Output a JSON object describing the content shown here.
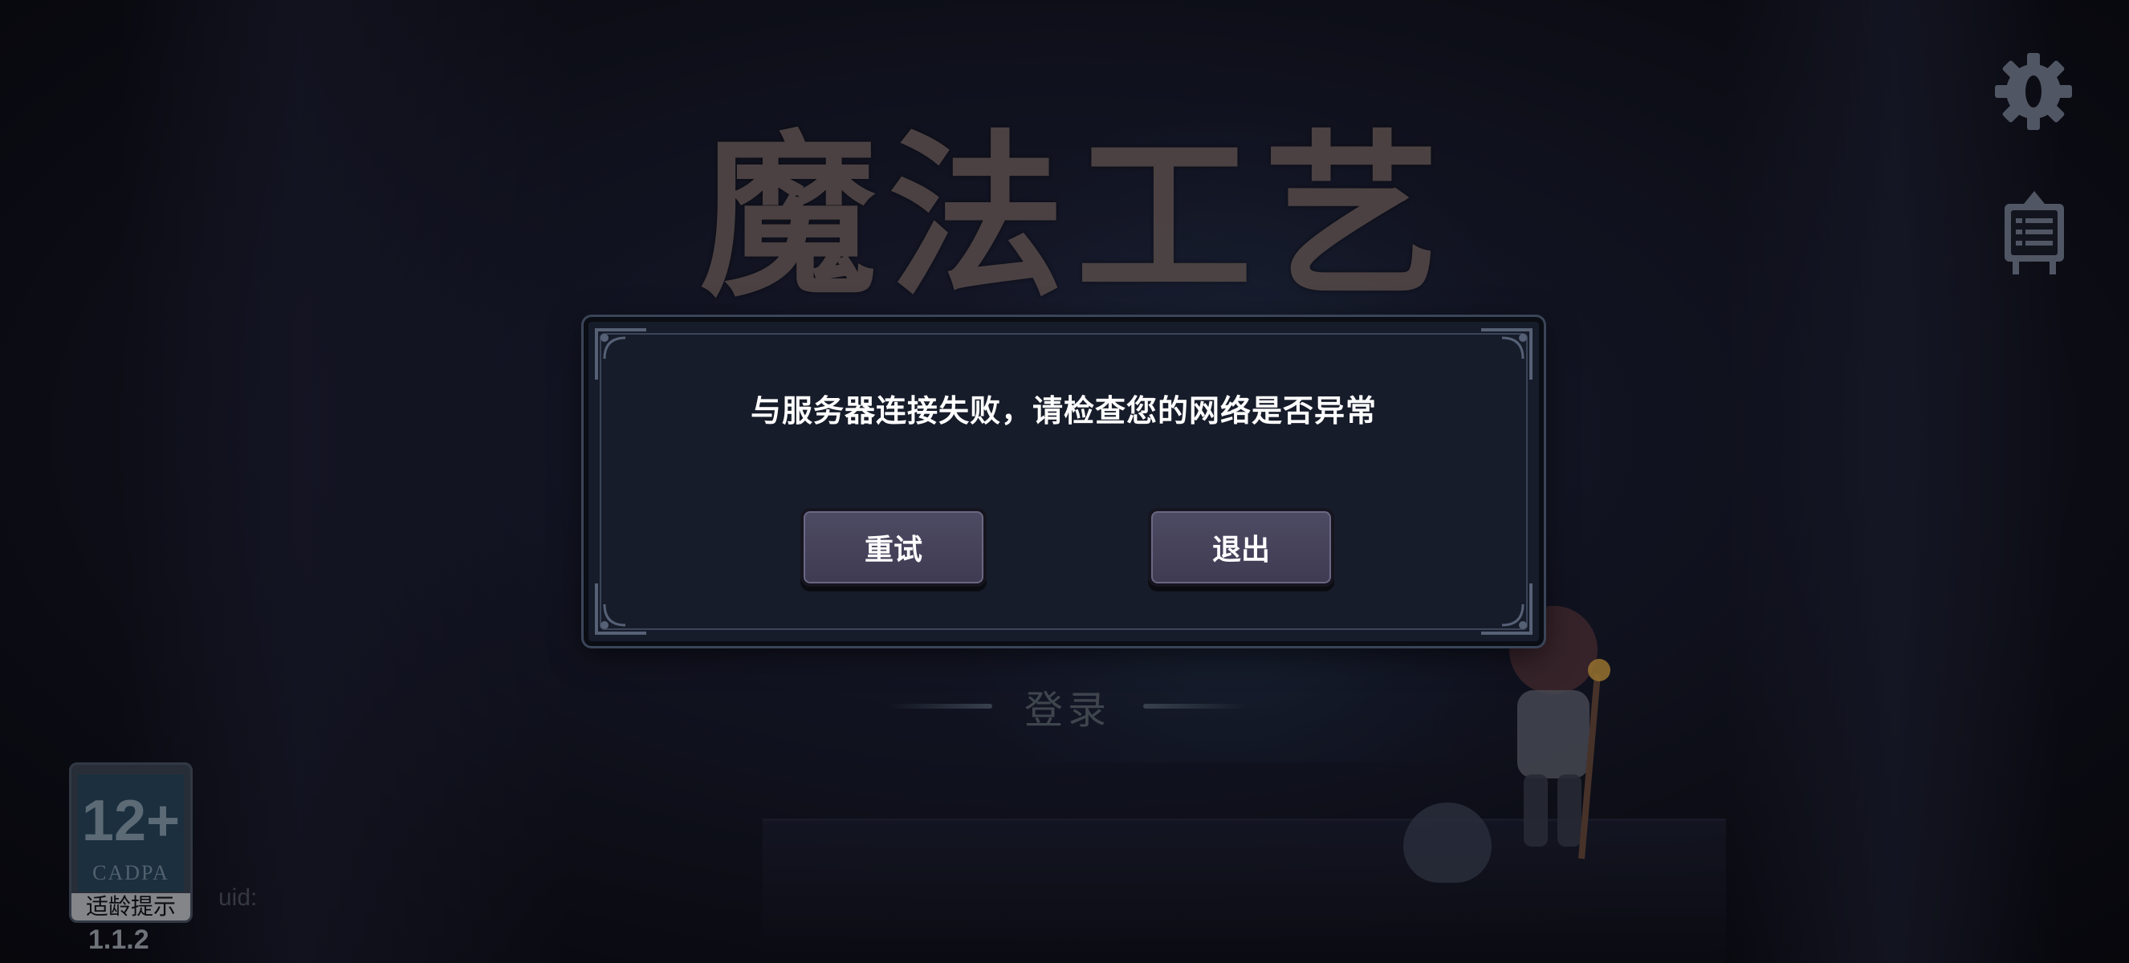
{
  "background": {
    "game_title": "魔法工艺",
    "login_label": "登录"
  },
  "top_right": {
    "settings_icon": "gear-icon",
    "notice_icon": "notice-board-icon"
  },
  "age_rating": {
    "number": "12+",
    "org": "CADPA",
    "caption": "适龄提示"
  },
  "footer": {
    "version": "1.1.2",
    "uid_label": "uid:"
  },
  "dialog": {
    "message": "与服务器连接失败，请检查您的网络是否异常",
    "retry_label": "重试",
    "exit_label": "退出"
  },
  "colors": {
    "dialog_bg": "#171c2a",
    "button_bg": "#4d4a63",
    "text": "#ffffff"
  }
}
